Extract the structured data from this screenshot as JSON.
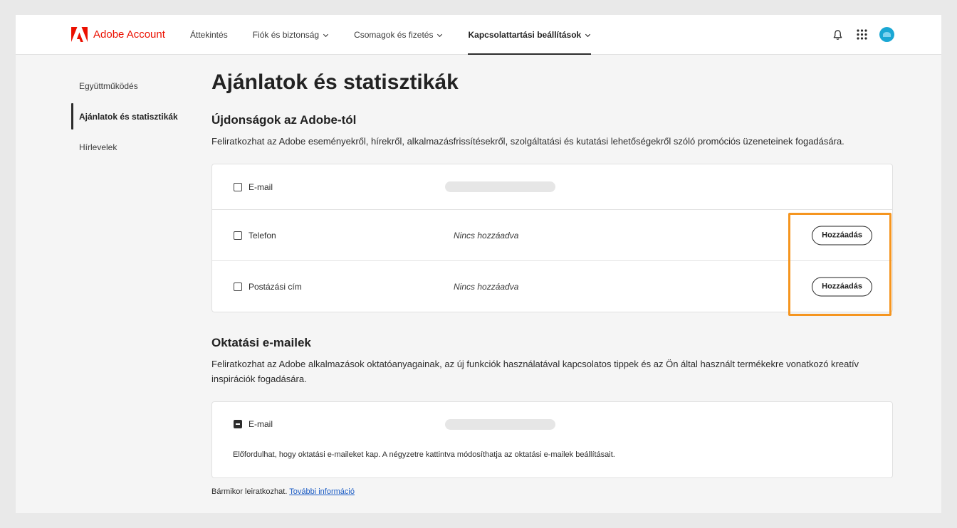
{
  "header": {
    "brand_name": "Adobe Account",
    "nav": [
      {
        "label": "Áttekintés",
        "has_dropdown": false
      },
      {
        "label": "Fiók és biztonság",
        "has_dropdown": true
      },
      {
        "label": "Csomagok és fizetés",
        "has_dropdown": true
      },
      {
        "label": "Kapcsolattartási beállítások",
        "has_dropdown": true,
        "active": true
      }
    ],
    "icons": [
      "bell-icon",
      "apps-grid-icon",
      "avatar"
    ]
  },
  "sidebar": {
    "items": [
      {
        "label": "Együttműködés"
      },
      {
        "label": "Ajánlatok és statisztikák",
        "active": true
      },
      {
        "label": "Hírlevelek"
      }
    ]
  },
  "main": {
    "title": "Ajánlatok és statisztikák",
    "section1": {
      "heading": "Újdonságok az Adobe-tól",
      "description": "Feliratkozhat az Adobe eseményekről, hírekről, alkalmazásfrissítésekről, szolgáltatási és kutatási lehetőségekről szóló promóciós üzeneteinek fogadására.",
      "rows": [
        {
          "label": "E-mail",
          "checked": false
        },
        {
          "label": "Telefon",
          "checked": false,
          "status": "Nincs hozzáadva",
          "button": "Hozzáadás"
        },
        {
          "label": "Postázási cím",
          "checked": false,
          "status": "Nincs hozzáadva",
          "button": "Hozzáadás"
        }
      ]
    },
    "section2": {
      "heading": "Oktatási e-mailek",
      "description": "Feliratkozhat az Adobe alkalmazások oktatóanyagainak, az új funkciók használatával kapcsolatos tippek és az Ön által használt termékekre vonatkozó kreatív inspirációk fogadására.",
      "row": {
        "label": "E-mail",
        "state": "indeterminate"
      },
      "note": "Előfordulhat, hogy oktatási e-maileket kap. A négyzetre kattintva módosíthatja az oktatási e-mailek beállításait."
    },
    "footer": {
      "text": "Bármikor leiratkozhat.",
      "link": "További információ"
    }
  },
  "colors": {
    "brand_red": "#eb1000",
    "highlight": "#f5951f",
    "link": "#1a5bc4",
    "avatar": "#1aa7d4"
  }
}
